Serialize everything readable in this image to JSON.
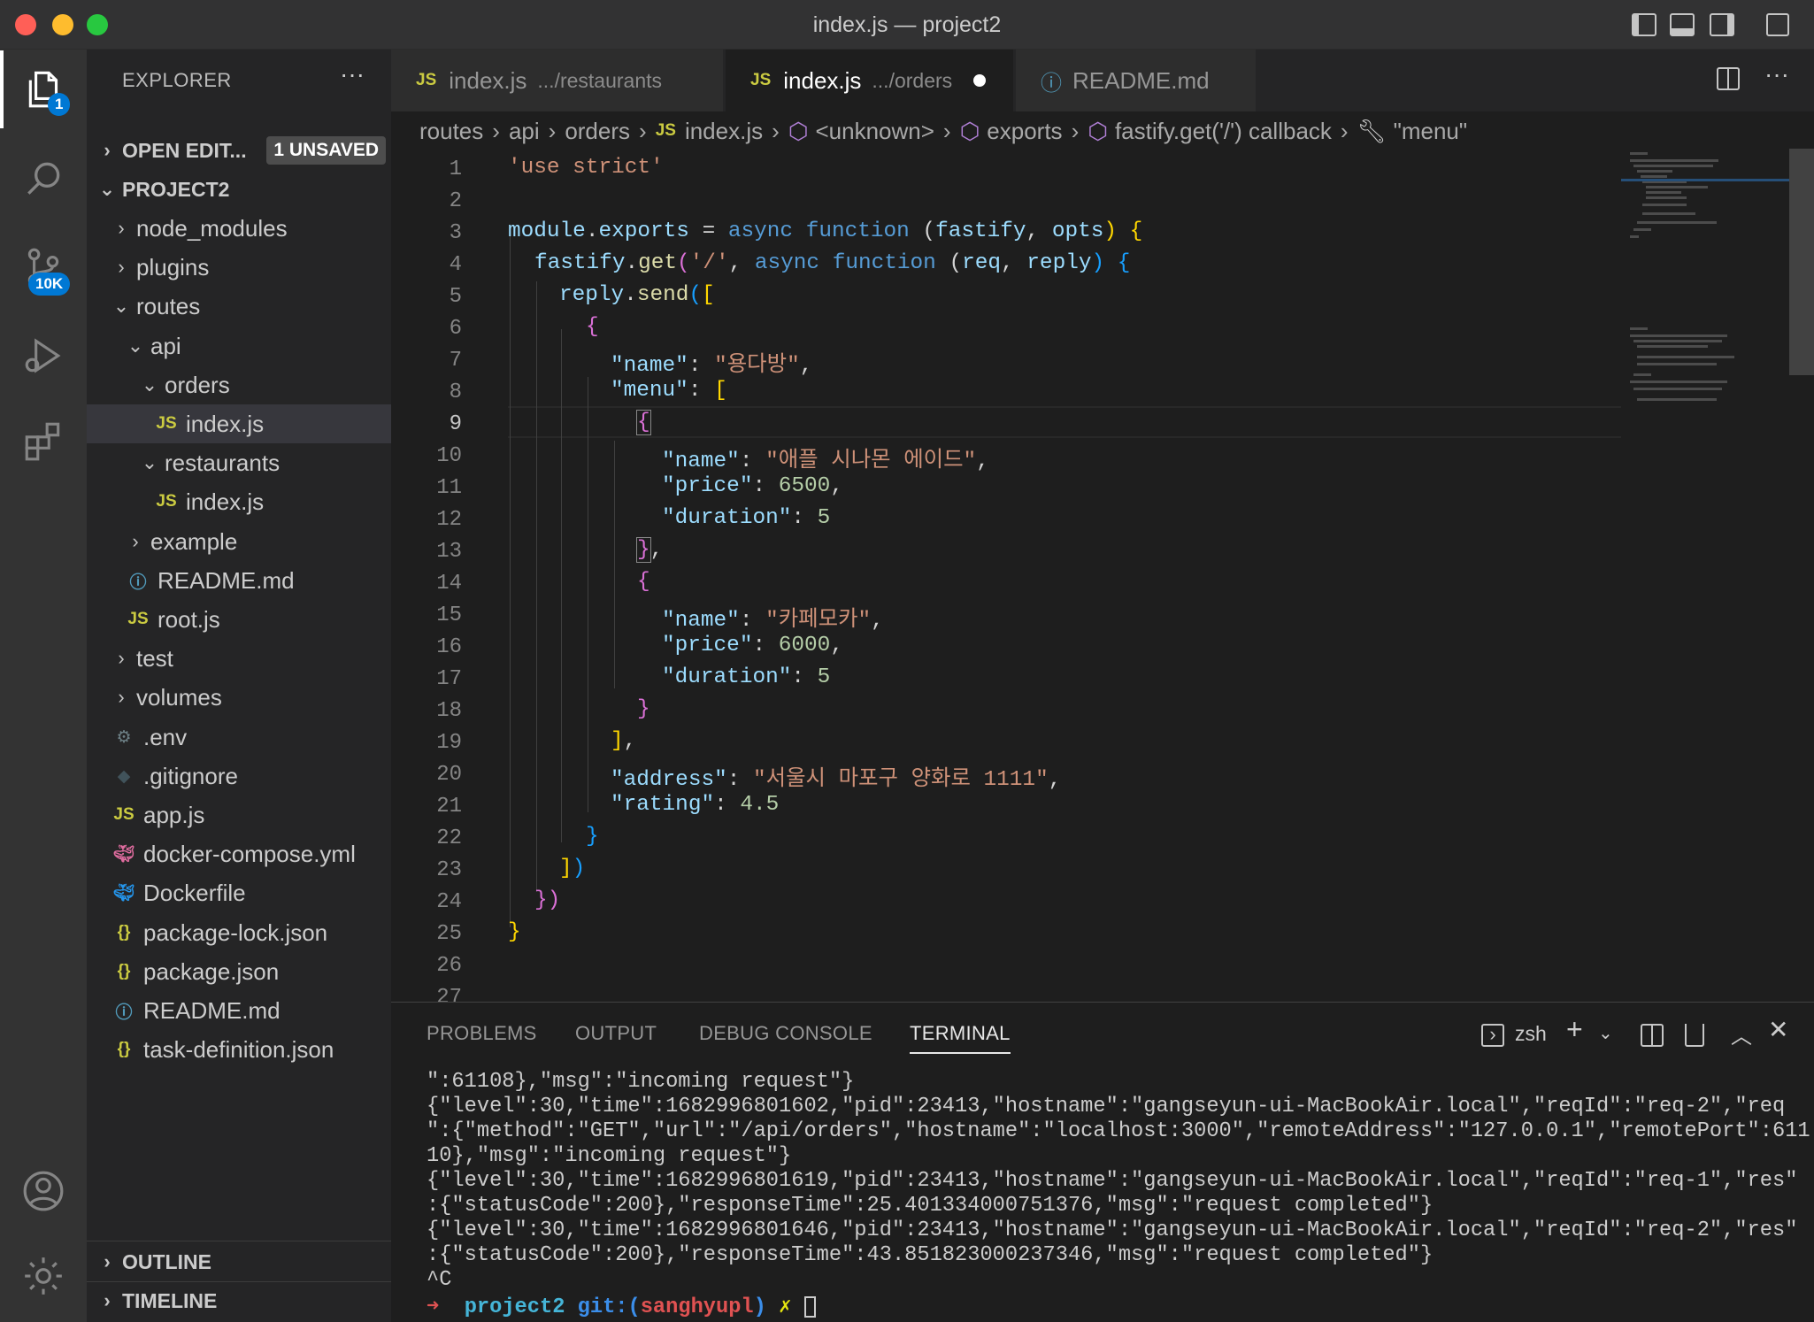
{
  "window": {
    "title": "index.js — project2"
  },
  "activity": {
    "explorer_badge": "1",
    "scm_badge": "10K",
    "items": [
      "files-icon",
      "search-icon",
      "source-control-icon",
      "run-debug-icon",
      "extensions-icon",
      "account-icon",
      "settings-gear-icon"
    ]
  },
  "sidebar": {
    "title": "EXPLORER",
    "more": "···",
    "open_editors": {
      "label": "OPEN EDIT...",
      "badge": "1 UNSAVED"
    },
    "project": "PROJECT2",
    "tree": [
      {
        "label": "node_modules",
        "type": "folder",
        "open": false,
        "depth": 1
      },
      {
        "label": "plugins",
        "type": "folder",
        "open": false,
        "depth": 1
      },
      {
        "label": "routes",
        "type": "folder",
        "open": true,
        "depth": 1
      },
      {
        "label": "api",
        "type": "folder",
        "open": true,
        "depth": 2
      },
      {
        "label": "orders",
        "type": "folder",
        "open": true,
        "depth": 3
      },
      {
        "label": "index.js",
        "type": "js",
        "depth": 4,
        "selected": true
      },
      {
        "label": "restaurants",
        "type": "folder",
        "open": true,
        "depth": 3
      },
      {
        "label": "index.js",
        "type": "js",
        "depth": 4
      },
      {
        "label": "example",
        "type": "folder",
        "open": false,
        "depth": 2
      },
      {
        "label": "README.md",
        "type": "info",
        "depth": 2
      },
      {
        "label": "root.js",
        "type": "js",
        "depth": 2
      },
      {
        "label": "test",
        "type": "folder",
        "open": false,
        "depth": 1
      },
      {
        "label": "volumes",
        "type": "folder",
        "open": false,
        "depth": 1
      },
      {
        "label": ".env",
        "type": "gear",
        "depth": 1
      },
      {
        "label": ".gitignore",
        "type": "git",
        "depth": 1
      },
      {
        "label": "app.js",
        "type": "js",
        "depth": 1
      },
      {
        "label": "docker-compose.yml",
        "type": "docker-pink",
        "depth": 1
      },
      {
        "label": "Dockerfile",
        "type": "docker",
        "depth": 1
      },
      {
        "label": "package-lock.json",
        "type": "json",
        "depth": 1
      },
      {
        "label": "package.json",
        "type": "json",
        "depth": 1
      },
      {
        "label": "README.md",
        "type": "info",
        "depth": 1
      },
      {
        "label": "task-definition.json",
        "type": "json",
        "depth": 1
      }
    ],
    "outline": "OUTLINE",
    "timeline": "TIMELINE"
  },
  "tabs": [
    {
      "icon": "JS",
      "label": "index.js",
      "desc": ".../restaurants",
      "active": false
    },
    {
      "icon": "JS",
      "label": "index.js",
      "desc": ".../orders",
      "active": true,
      "dirty": true
    },
    {
      "icon": "info",
      "label": "README.md",
      "desc": "",
      "active": false
    }
  ],
  "breadcrumb": [
    "routes",
    "api",
    "orders",
    "index.js",
    "<unknown>",
    "exports",
    "fastify.get('/') callback",
    "\"menu\""
  ],
  "editor": {
    "current_line": 9,
    "line_numbers": [
      "1",
      "2",
      "3",
      "4",
      "5",
      "6",
      "7",
      "8",
      "9",
      "10",
      "11",
      "12",
      "13",
      "14",
      "15",
      "16",
      "17",
      "18",
      "19",
      "20",
      "21",
      "22",
      "23",
      "24",
      "25",
      "26",
      "27"
    ]
  },
  "code": {
    "l1": "'use strict'",
    "l3a": "module",
    "l3b": ".",
    "l3c": "exports",
    "l3d": " = ",
    "l3e": "async",
    "l3f": " ",
    "l3g": "function",
    "l3h": " (",
    "l3i": "fastify",
    "l3j": ", ",
    "l3k": "opts",
    "l3l": ") {",
    "l4a": "fastify",
    "l4b": ".",
    "l4c": "get",
    "l4d": "(",
    "l4e": "'/'",
    "l4f": ", ",
    "l4g": "async",
    "l4h": " ",
    "l4i": "function",
    "l4j": " (",
    "l4k": "req",
    "l4l": ", ",
    "l4m": "reply",
    "l4n": ") {",
    "l5a": "reply",
    "l5b": ".",
    "l5c": "send",
    "l5d": "(",
    "l5e": "[",
    "l6": "{",
    "l7a": "\"name\"",
    "l7b": ": ",
    "l7c": "\"용다방\"",
    "l7d": ",",
    "l8a": "\"menu\"",
    "l8b": ": ",
    "l8c": "[",
    "l9": "{",
    "l10a": "\"name\"",
    "l10b": ": ",
    "l10c": "\"애플 시나몬 에이드\"",
    "l10d": ",",
    "l11a": "\"price\"",
    "l11b": ": ",
    "l11c": "6500",
    "l11d": ",",
    "l12a": "\"duration\"",
    "l12b": ": ",
    "l12c": "5",
    "l13a": "}",
    "l13b": ",",
    "l14": "{",
    "l15a": "\"name\"",
    "l15b": ": ",
    "l15c": "\"카페모카\"",
    "l15d": ",",
    "l16a": "\"price\"",
    "l16b": ": ",
    "l16c": "6000",
    "l16d": ",",
    "l17a": "\"duration\"",
    "l17b": ": ",
    "l17c": "5",
    "l18": "}",
    "l19a": "]",
    "l19b": ",",
    "l20a": "\"address\"",
    "l20b": ": ",
    "l20c": "\"서울시 마포구 양화로 1111\"",
    "l20d": ",",
    "l21a": "\"rating\"",
    "l21b": ": ",
    "l21c": "4.5",
    "l22": "}",
    "l23a": "]",
    "l23b": ")",
    "l24a": "})",
    "l25": "}"
  },
  "panel": {
    "tabs": [
      "PROBLEMS",
      "OUTPUT",
      "DEBUG CONSOLE",
      "TERMINAL"
    ],
    "active_tab": "TERMINAL",
    "shell": "zsh",
    "terminal_lines": [
      "\":61108},\"msg\":\"incoming request\"}",
      "{\"level\":30,\"time\":1682996801602,\"pid\":23413,\"hostname\":\"gangseyun-ui-MacBookAir.local\",\"reqId\":\"req-2\",\"req",
      "\":{\"method\":\"GET\",\"url\":\"/api/orders\",\"hostname\":\"localhost:3000\",\"remoteAddress\":\"127.0.0.1\",\"remotePort\":611",
      "10},\"msg\":\"incoming request\"}",
      "{\"level\":30,\"time\":1682996801619,\"pid\":23413,\"hostname\":\"gangseyun-ui-MacBookAir.local\",\"reqId\":\"req-1\",\"res\"",
      ":{\"statusCode\":200},\"responseTime\":25.401334000751376,\"msg\":\"request completed\"}",
      "{\"level\":30,\"time\":1682996801646,\"pid\":23413,\"hostname\":\"gangseyun-ui-MacBookAir.local\",\"reqId\":\"req-2\",\"res\"",
      ":{\"statusCode\":200},\"responseTime\":43.851823000237346,\"msg\":\"request completed\"}",
      "^C"
    ],
    "prompt": {
      "arrow": "➜",
      "dir": "project2",
      "git": "git:(",
      "branch": "sanghyupl",
      "git_close": ")",
      "mark": "✗"
    }
  },
  "colors": {
    "accent": "#0078d4",
    "string": "#ce9178",
    "keyword": "#569cd6",
    "variable": "#9cdcfe",
    "function": "#dcdcaa",
    "number": "#b5cea8"
  }
}
